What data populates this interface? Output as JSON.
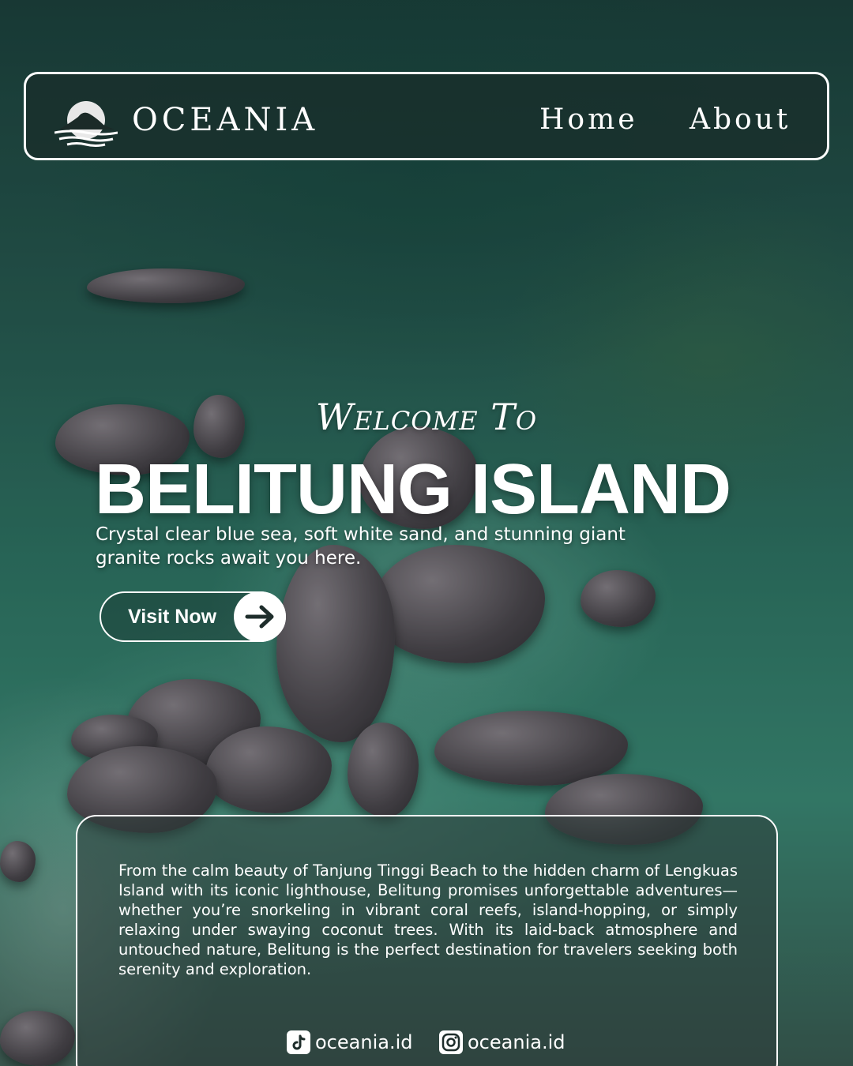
{
  "header": {
    "brand": "OCEANIA",
    "nav": [
      {
        "label": "Home"
      },
      {
        "label": "About"
      }
    ]
  },
  "hero": {
    "welcome": "Welcome To",
    "title": "BELITUNG ISLAND",
    "subtitle": "Crystal clear blue sea, soft white sand, and stunning giant granite rocks await you here.",
    "cta_label": "Visit Now"
  },
  "info": {
    "paragraph": "From the calm beauty of Tanjung Tinggi Beach to the hidden charm of Lengkuas Island with its iconic lighthouse, Belitung promises unforgettable adventures—whether you’re snorkeling in vibrant coral reefs, island-hopping, or simply relaxing under swaying coconut trees. With its laid-back atmosphere and untouched nature, Belitung is the perfect destination for travelers seeking both serenity and exploration."
  },
  "socials": [
    {
      "icon": "tiktok-icon",
      "handle": "oceania.id"
    },
    {
      "icon": "instagram-icon",
      "handle": "oceania.id"
    }
  ],
  "colors": {
    "text": "#ffffff",
    "navbar_bg": "#192d2a",
    "sea": "#2f7765"
  }
}
